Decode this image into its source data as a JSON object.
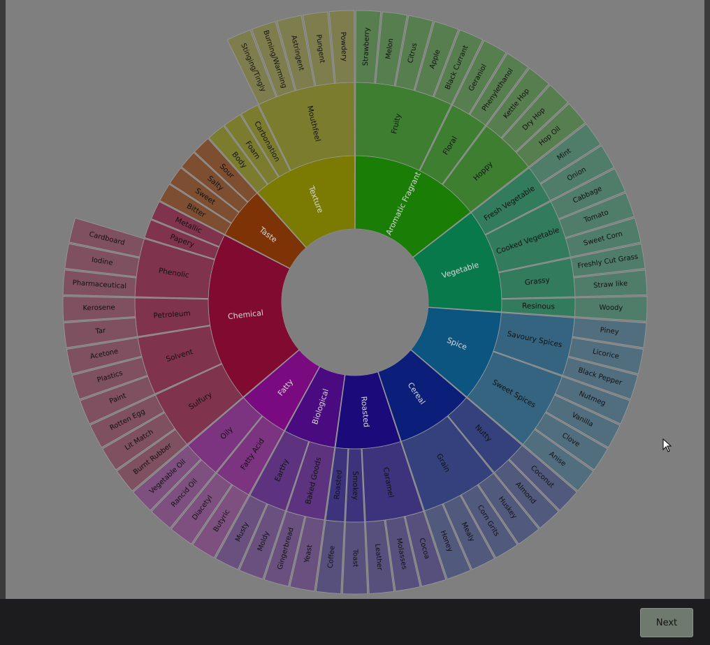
{
  "wheel": {
    "inner": [
      {
        "label": "Aromatic Fragrant",
        "color": "#1a7d06",
        "mid": [
          {
            "label": "Fruity",
            "outer": [
              "Strawberry",
              "Melon",
              "Citrus",
              "Apple",
              "Black Currant"
            ]
          },
          {
            "label": "Floral",
            "outer": [
              "Geraniol",
              "Phenylethanol"
            ]
          },
          {
            "label": "Hoppy",
            "outer": [
              "Kettle Hop",
              "Dry Hop",
              "Hop Oil"
            ]
          }
        ]
      },
      {
        "label": "Vegetable",
        "color": "#08794a",
        "mid": [
          {
            "label": "Fresh Vegetable",
            "outer": [
              "Mint",
              "Onion"
            ]
          },
          {
            "label": "Cooked Vegetable",
            "outer": [
              "Cabbage",
              "Tomato",
              "Sweet Corn"
            ]
          },
          {
            "label": "Grassy",
            "outer": [
              "Freshly Cut Grass",
              "Straw like"
            ]
          },
          {
            "label": "Resinous",
            "outer": [
              "Woody"
            ]
          }
        ]
      },
      {
        "label": "Spice",
        "color": "#0b5580",
        "mid": [
          {
            "label": "Savoury Spices",
            "outer": [
              "Piney",
              "Licorice",
              "Black Pepper"
            ]
          },
          {
            "label": "Sweet Spices",
            "outer": [
              "Nutmeg",
              "Vanilla",
              "Clove",
              "Anise"
            ]
          }
        ]
      },
      {
        "label": "Cereal",
        "color": "#0b1f7a",
        "mid": [
          {
            "label": "Nutty",
            "outer": [
              "Coconut",
              "Almond"
            ]
          },
          {
            "label": "Grain",
            "outer": [
              "Huskey",
              "Corn Grits",
              "Mealy",
              "Honey"
            ]
          }
        ]
      },
      {
        "label": "Roasted",
        "color": "#1a0a7a",
        "mid": [
          {
            "label": "Caramel",
            "outer": [
              "Cocoa",
              "Molasses",
              "Leather"
            ]
          },
          {
            "label": "Smokey",
            "outer": [
              "Toast"
            ]
          },
          {
            "label": "Roasted",
            "outer": [
              "Coffee"
            ]
          }
        ]
      },
      {
        "label": "Biological",
        "color": "#4a0a80",
        "mid": [
          {
            "label": "Baked Goods",
            "outer": [
              "Yeast",
              "Gingerbread"
            ]
          },
          {
            "label": "Earthy",
            "outer": [
              "Moldy",
              "Musty"
            ]
          }
        ]
      },
      {
        "label": "Fatty",
        "color": "#7a0a80",
        "mid": [
          {
            "label": "Fatty Acid",
            "outer": [
              "Butyric",
              "Diacetyl"
            ]
          },
          {
            "label": "Oily",
            "outer": [
              "Rancid Oil",
              "Vegetable Oil"
            ]
          }
        ]
      },
      {
        "label": "Chemical",
        "color": "#800a30",
        "mid": [
          {
            "label": "Sulfury",
            "outer": [
              "Burnt Rubber",
              "Lit Match",
              "Rotten Egg"
            ]
          },
          {
            "label": "Solvent",
            "outer": [
              "Paint",
              "Plastics",
              "Acetone"
            ]
          },
          {
            "label": "Petroleum",
            "outer": [
              "Tar",
              "Kerosene"
            ]
          },
          {
            "label": "Phenolic",
            "outer": [
              "Pharmaceutical",
              "Iodine",
              "Cardboard"
            ]
          },
          {
            "label": "Papery",
            "outer": []
          },
          {
            "label": "Metallic",
            "outer": []
          }
        ]
      },
      {
        "label": "Taste",
        "color": "#7d3305",
        "mid": [
          {
            "label": "Bitter",
            "outer": []
          },
          {
            "label": "Sweet",
            "outer": []
          },
          {
            "label": "Salty",
            "outer": []
          },
          {
            "label": "Sour",
            "outer": []
          }
        ]
      },
      {
        "label": "Texture",
        "color": "#7b7b04",
        "mid": [
          {
            "label": "Body",
            "outer": []
          },
          {
            "label": "Foam",
            "outer": []
          },
          {
            "label": "Carbonation",
            "outer": []
          },
          {
            "label": "Mouthfeel",
            "outer": [
              "Stinging/Tingly",
              "Burning/Warming",
              "Astringent",
              "Pungent",
              "Powdery"
            ]
          }
        ]
      }
    ]
  },
  "footer": {
    "next_label": "Next"
  }
}
